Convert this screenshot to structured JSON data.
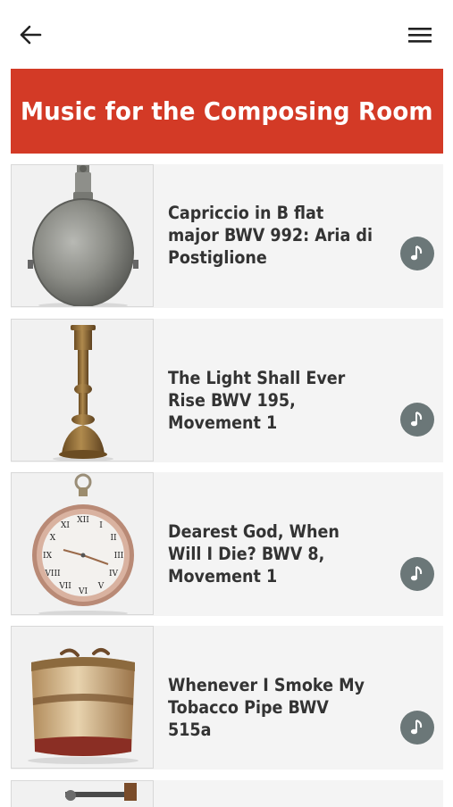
{
  "header": {
    "back_icon": "arrow-left-icon",
    "menu_icon": "hamburger-menu-icon"
  },
  "banner": {
    "title": "Music for the Composing Room",
    "color": "#d33a26"
  },
  "items": [
    {
      "title": "Capriccio in B flat major BWV 992: Aria di Postiglione",
      "image": "pewter-flask",
      "icon": "music-note-icon"
    },
    {
      "title": "The Light Shall Ever Rise BWV 195, Movement 1",
      "image": "brass-candlestick",
      "icon": "music-note-icon"
    },
    {
      "title": "Dearest God, When Will I Die? BWV 8, Movement 1",
      "image": "pocket-watch",
      "icon": "music-note-icon"
    },
    {
      "title": "Whenever I Smoke My Tobacco Pipe BWV 515a",
      "image": "tobacco-box",
      "icon": "music-note-icon"
    }
  ],
  "colors": {
    "audio_button": "#6b7778",
    "card_background": "#f4f4f4",
    "title_text": "#333333"
  }
}
